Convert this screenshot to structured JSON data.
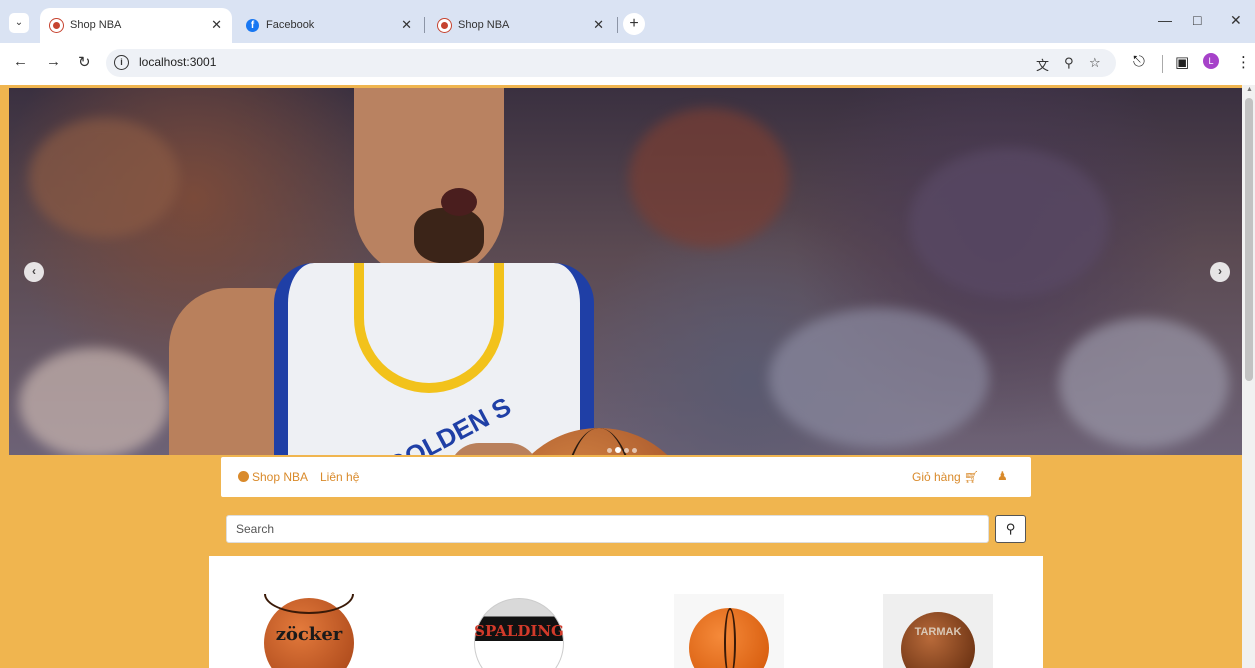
{
  "browser": {
    "tabs": [
      {
        "title": "Shop NBA",
        "active": true
      },
      {
        "title": "Facebook",
        "active": false
      },
      {
        "title": "Shop NBA",
        "active": false
      }
    ],
    "url": "localhost:3001",
    "profile_initial": "L",
    "icons": [
      "tab-search-icon",
      "back-icon",
      "forward-icon",
      "reload-icon",
      "translate-icon",
      "zoom-icon",
      "star-icon",
      "extensions-icon",
      "sidepanel-icon",
      "menu-icon",
      "minimize-icon",
      "restore-icon",
      "close-icon"
    ]
  },
  "hero": {
    "jersey_text": "GOLDEN S",
    "prev_icon": "chevron-left-icon",
    "next_icon": "chevron-right-icon",
    "slides": 4,
    "active_slide": 2
  },
  "navbar": {
    "brand": "Shop NBA",
    "contact": "Liên hệ",
    "cart": "Giỏ hàng"
  },
  "search": {
    "placeholder": "Search"
  },
  "products": [
    {
      "label": "zöcker"
    },
    {
      "label": "SPALDING"
    },
    {
      "label": ""
    },
    {
      "label": "TARMAK"
    }
  ],
  "colors": {
    "page_bg": "#f0b54f",
    "accent": "#d98a2b"
  }
}
